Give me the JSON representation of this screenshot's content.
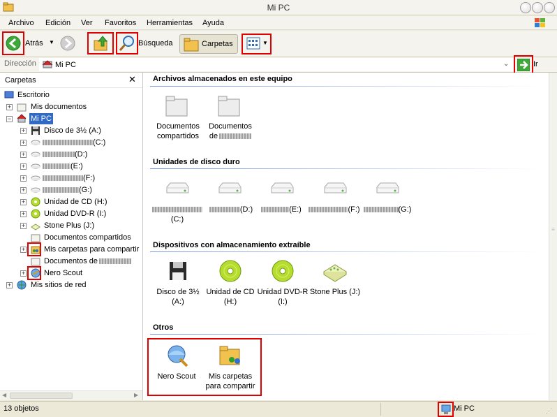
{
  "window": {
    "title": "Mi PC"
  },
  "menu": [
    "Archivo",
    "Edición",
    "Ver",
    "Favoritos",
    "Herramientas",
    "Ayuda"
  ],
  "toolbar": {
    "back_label": "Atrás",
    "search_label": "Búsqueda",
    "folders_label": "Carpetas"
  },
  "address": {
    "label": "Dirección",
    "value": "Mi PC",
    "go_label": "Ir"
  },
  "left_panel": {
    "title": "Carpetas",
    "items": [
      {
        "label": "Escritorio"
      },
      {
        "label": "Mis documentos"
      },
      {
        "label": "Mi PC"
      },
      {
        "label": "Disco de 3½ (A:)"
      },
      {
        "label": "(C:)"
      },
      {
        "label": "(D:)"
      },
      {
        "label": "(E:)"
      },
      {
        "label": "(F:)"
      },
      {
        "label": "(G:)"
      },
      {
        "label": "Unidad de CD (H:)"
      },
      {
        "label": "Unidad DVD-R (I:)"
      },
      {
        "label": "Stone Plus (J:)"
      },
      {
        "label": "Documentos compartidos"
      },
      {
        "label": "Mis carpetas para compartir"
      },
      {
        "label": "Documentos de"
      },
      {
        "label": "Nero Scout"
      },
      {
        "label": "Mis sitios de red"
      }
    ]
  },
  "sections": {
    "stored": {
      "title": "Archivos almacenados en este equipo",
      "items": [
        {
          "line1": "Documentos",
          "line2": "compartidos"
        },
        {
          "line1": "Documentos",
          "line2": "de"
        }
      ]
    },
    "disks": {
      "title": "Unidades de disco duro",
      "items": [
        {
          "label": "(C:)"
        },
        {
          "label": "(D:)"
        },
        {
          "label": "(E:)"
        },
        {
          "label": "(F:)"
        },
        {
          "label": "(G:)"
        }
      ]
    },
    "removable": {
      "title": "Dispositivos con almacenamiento extraíble",
      "items": [
        {
          "line1": "Disco de 3½",
          "line2": "(A:)"
        },
        {
          "line1": "Unidad de CD",
          "line2": "(H:)"
        },
        {
          "line1": "Unidad DVD-R",
          "line2": "(I:)"
        },
        {
          "line1": "Stone Plus (J:)",
          "line2": ""
        }
      ]
    },
    "others": {
      "title": "Otros",
      "items": [
        {
          "line1": "Nero Scout",
          "line2": ""
        },
        {
          "line1": "Mis carpetas",
          "line2": "para compartir"
        }
      ]
    }
  },
  "status": {
    "count": "13 objetos",
    "location": "Mi PC"
  },
  "colors": {
    "highlight": "#e00000",
    "selection": "#316ac5",
    "section_line": "#7a96df"
  }
}
